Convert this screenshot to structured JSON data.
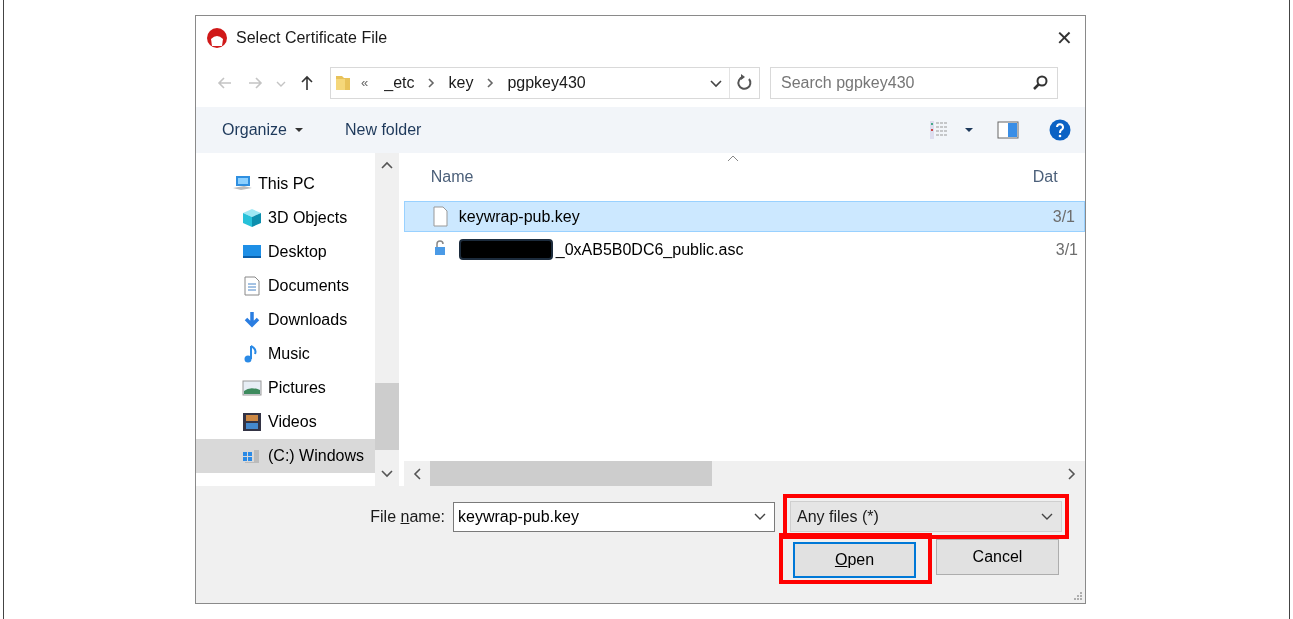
{
  "window": {
    "title": "Select Certificate File",
    "close": "✕"
  },
  "address_bar": {
    "nav_buttons": [
      {
        "kind": "back",
        "disabled": true
      },
      {
        "kind": "forward",
        "disabled": true
      },
      {
        "kind": "recent",
        "disabled": true
      },
      {
        "kind": "up",
        "disabled": false
      }
    ],
    "overflow": "«",
    "path": [
      "_etc",
      "key",
      "pgpkey430"
    ]
  },
  "search": {
    "placeholder": "Search pgpkey430"
  },
  "toolbar": {
    "items": [
      {
        "label": "Organize",
        "dropdown": true
      },
      {
        "label": "New folder",
        "dropdown": false
      }
    ]
  },
  "nav_pane": {
    "items": [
      {
        "label": "This PC",
        "kind": "pc",
        "selected": false,
        "children": [
          {
            "label": "3D Objects",
            "kind": "cube",
            "selected": false
          },
          {
            "label": "Desktop",
            "kind": "desktop",
            "selected": false
          },
          {
            "label": "Documents",
            "kind": "documents",
            "selected": false
          },
          {
            "label": "Downloads",
            "kind": "downloads",
            "selected": false
          },
          {
            "label": "Music",
            "kind": "music",
            "selected": false
          },
          {
            "label": "Pictures",
            "kind": "pictures",
            "selected": false
          },
          {
            "label": "Videos",
            "kind": "videos",
            "selected": false
          },
          {
            "label": "(C:) Windows",
            "kind": "drive",
            "selected": true
          }
        ]
      }
    ]
  },
  "file_list": {
    "columns": [
      {
        "label": "Name",
        "sorted": true
      },
      {
        "label": "Dat",
        "sorted": false
      }
    ],
    "rows": [
      {
        "name": "keywrap-pub.key",
        "date": "3/1",
        "kind": "file",
        "redacted": false,
        "selected": true
      },
      {
        "name": "_0xAB5B0DC6_public.asc",
        "date": "3/1",
        "kind": "locked",
        "redacted": true,
        "selected": false
      }
    ]
  },
  "footer": {
    "file_name_label": [
      {
        "text": "File ",
        "underlined": false
      },
      {
        "text": "n",
        "underlined": true
      },
      {
        "text": "ame:",
        "underlined": false
      }
    ],
    "file_name": "keywrap-pub.key",
    "file_type": {
      "value": "Any files (*)",
      "highlighted": true
    },
    "buttons": [
      {
        "label": [
          {
            "text": "O",
            "underlined": true
          },
          {
            "text": "pen",
            "underlined": false
          }
        ],
        "default": true,
        "highlighted": true
      },
      {
        "label": [
          {
            "text": "Cancel",
            "underlined": false
          }
        ],
        "default": false,
        "highlighted": false
      }
    ]
  }
}
